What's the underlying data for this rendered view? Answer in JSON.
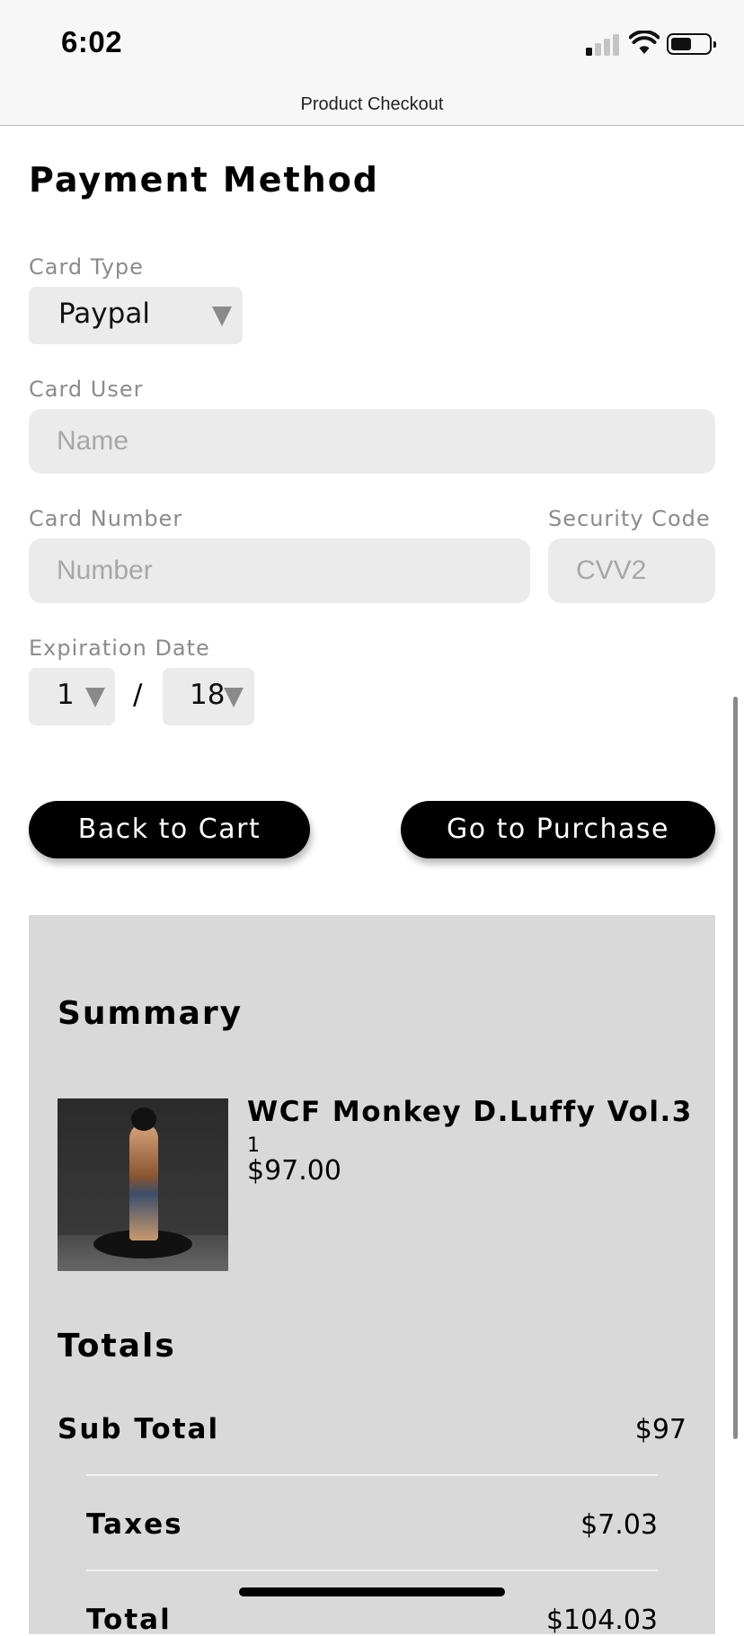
{
  "status_bar": {
    "time": "6:02"
  },
  "nav": {
    "title": "Product Checkout"
  },
  "payment": {
    "heading": "Payment Method",
    "card_type": {
      "label": "Card Type",
      "value": "Paypal"
    },
    "card_user": {
      "label": "Card User",
      "placeholder": "Name"
    },
    "card_number": {
      "label": "Card Number",
      "placeholder": "Number"
    },
    "security_code": {
      "label": "Security Code",
      "placeholder": "CVV2"
    },
    "expiration": {
      "label": "Expiration Date",
      "month": "1",
      "separator": "/",
      "year": "18"
    }
  },
  "buttons": {
    "back": "Back to Cart",
    "purchase": "Go to Purchase"
  },
  "summary": {
    "heading": "Summary",
    "item": {
      "name": "WCF Monkey D.Luffy Vol.3",
      "quantity": "1",
      "price": "$97.00"
    },
    "totals_heading": "Totals",
    "sub_total": {
      "label": "Sub Total",
      "value": "$97"
    },
    "taxes": {
      "label": "Taxes",
      "value": "$7.03"
    },
    "total": {
      "label": "Total",
      "value": "$104.03"
    }
  },
  "colors": {
    "button_bg": "#000000",
    "summary_bg": "#d9d9d9",
    "input_bg": "#ebebeb",
    "label_text": "#8b8b8b"
  },
  "icons": [
    "signal-icon",
    "wifi-icon",
    "battery-icon",
    "caret-down-icon"
  ]
}
